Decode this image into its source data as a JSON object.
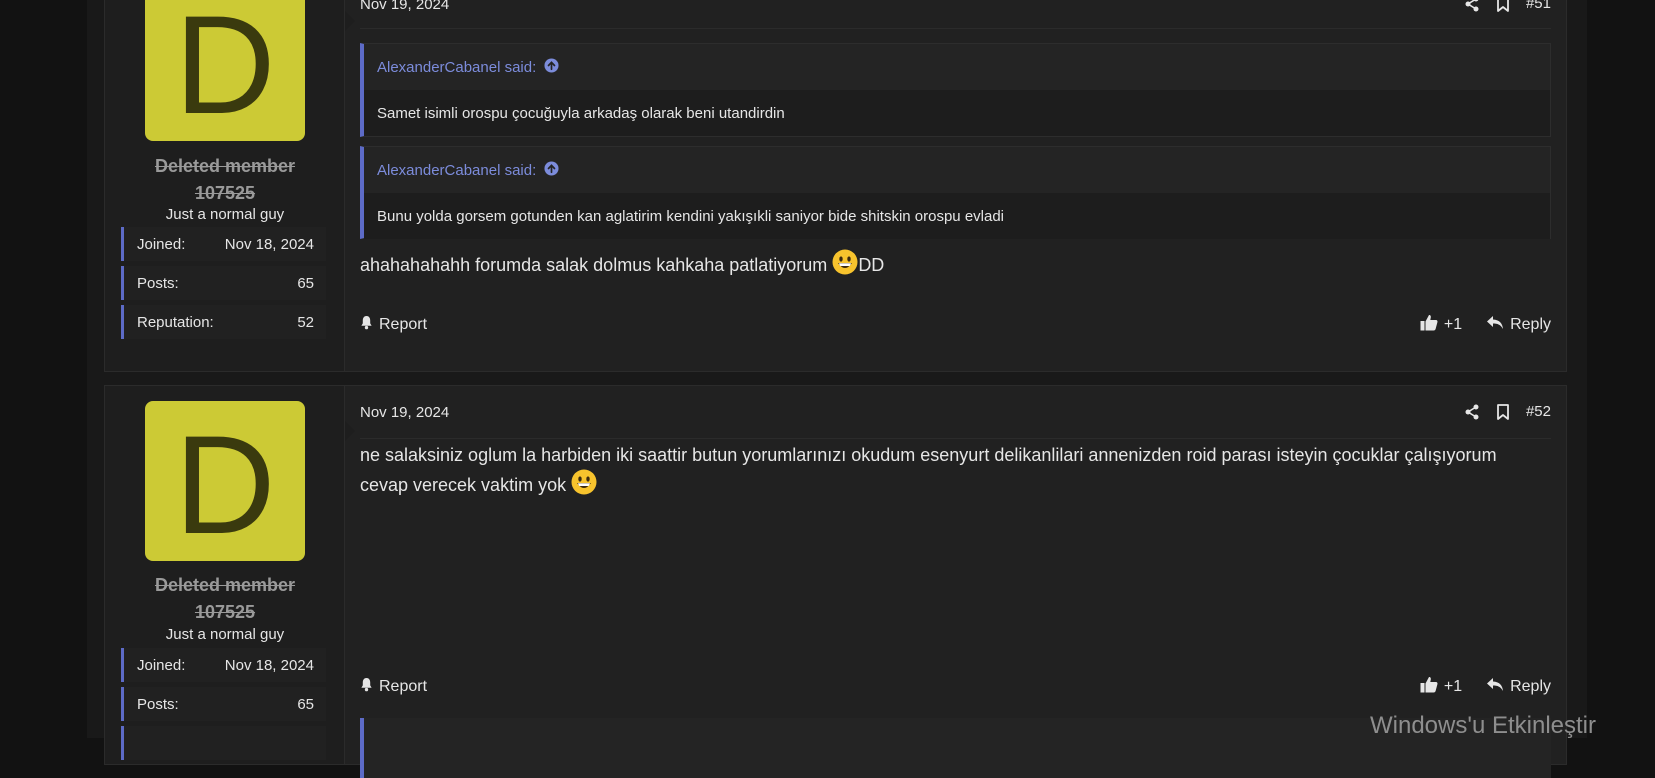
{
  "posts": [
    {
      "avatar_letter": "D",
      "avatar_color": "#ccca35",
      "username_line1": "Deleted member",
      "username_line2": "107525",
      "user_title": "Just a normal guy",
      "stats": [
        {
          "label": "Joined:",
          "value": "Nov 18, 2024"
        },
        {
          "label": "Posts:",
          "value": "65"
        },
        {
          "label": "Reputation:",
          "value": "52"
        }
      ],
      "date": "Nov 19, 2024",
      "number": "#51",
      "quotes": [
        {
          "author": "AlexanderCabanel said:",
          "text": "Samet isimli orospu çocuğuyla arkadaş olarak beni utandirdin"
        },
        {
          "author": "AlexanderCabanel said:",
          "text": "Bunu yolda gorsem gotunden kan aglatirim kendini yakışıkli saniyor bide shitskin orospu evladi"
        }
      ],
      "body_before_emoji": "ahahahahahh forumda salak dolmus kahkaha patlatiyorum ",
      "body_after_emoji": "DD",
      "report_label": "Report",
      "like_count": "+1",
      "reply_label": "Reply"
    },
    {
      "avatar_letter": "D",
      "avatar_color": "#ccca35",
      "username_line1": "Deleted member",
      "username_line2": "107525",
      "user_title": "Just a normal guy",
      "stats": [
        {
          "label": "Joined:",
          "value": "Nov 18, 2024"
        },
        {
          "label": "Posts:",
          "value": "65"
        }
      ],
      "date": "Nov 19, 2024",
      "number": "#52",
      "body_line1": "ne salaksiniz oglum la harbiden iki saattir butun yorumlarınızı okudum esenyurt delikanlilari annenizden roid parası isteyin çocuklar çalışıyorum",
      "body_line2": "cevap verecek vaktim yok ",
      "report_label": "Report",
      "like_count": "+1",
      "reply_label": "Reply"
    }
  ],
  "watermark": "Windows'u Etkinleştir"
}
